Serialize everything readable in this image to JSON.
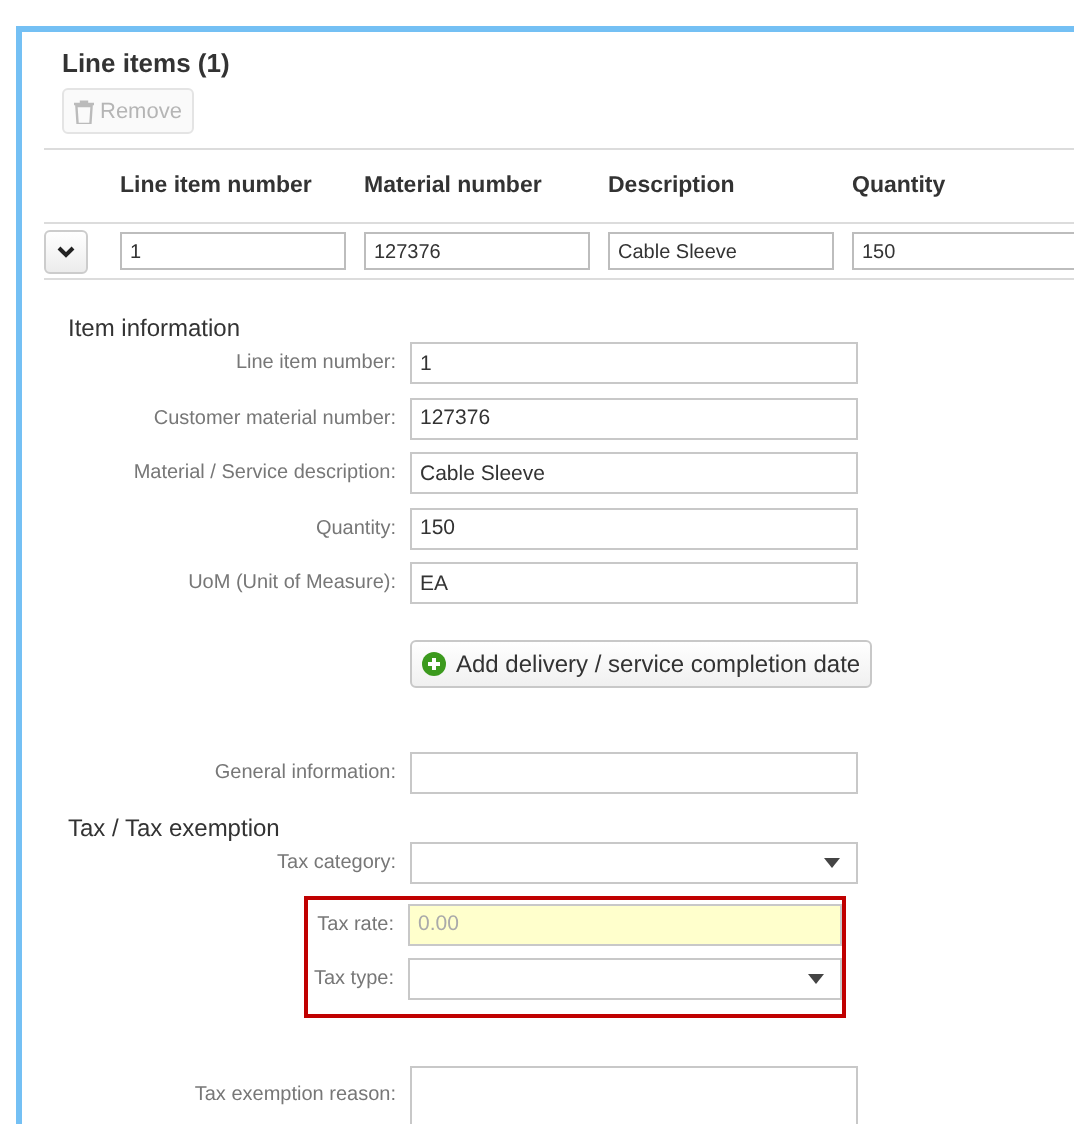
{
  "panel": {
    "title": "Line items (1)",
    "remove_button": {
      "label": "Remove",
      "disabled": true
    }
  },
  "table": {
    "columns": [
      "Line item number",
      "Material number",
      "Description",
      "Quantity"
    ],
    "rows": [
      {
        "expanded": true,
        "cells": [
          "1",
          "127376",
          "Cable Sleeve",
          "150"
        ]
      }
    ]
  },
  "sections": [
    {
      "heading": "Item information",
      "items": [
        {
          "kind": "text",
          "label": "Line item number:",
          "value": "1"
        },
        {
          "kind": "text",
          "label": "Customer material number:",
          "value": "127376"
        },
        {
          "kind": "text",
          "label": "Material / Service description:",
          "value": "Cable Sleeve"
        },
        {
          "kind": "text",
          "label": "Quantity:",
          "value": "150"
        },
        {
          "kind": "text",
          "label": "UoM (Unit of Measure):",
          "value": "EA"
        },
        {
          "kind": "button",
          "label": "Add delivery / service completion date"
        },
        {
          "kind": "text",
          "label": "General information:"
        }
      ]
    },
    {
      "heading": "Tax / Tax exemption",
      "items": [
        {
          "kind": "select",
          "label": "Tax category:"
        },
        {
          "kind": "group",
          "flagged": true,
          "items": [
            {
              "kind": "text",
              "label": "Tax rate:",
              "placeholder": "0.00",
              "highlighted": true
            },
            {
              "kind": "select",
              "label": "Tax type:"
            }
          ]
        },
        {
          "kind": "textarea",
          "label": "Tax exemption reason:"
        }
      ]
    }
  ]
}
